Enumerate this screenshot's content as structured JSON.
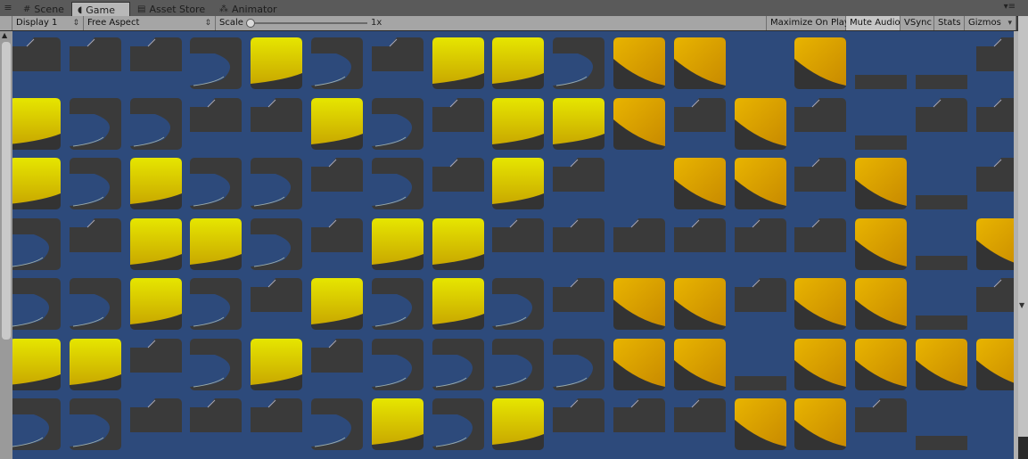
{
  "tabs": [
    {
      "label": "Scene",
      "icon": "scene-icon",
      "glyph": "#",
      "active": false
    },
    {
      "label": "Game",
      "icon": "game-icon",
      "glyph": "◖",
      "active": true
    },
    {
      "label": "Asset Store",
      "icon": "asset-store-icon",
      "glyph": "▤",
      "active": false
    },
    {
      "label": "Animator",
      "icon": "animator-icon",
      "glyph": "⁂",
      "active": false
    }
  ],
  "toolbar": {
    "display": "Display 1",
    "aspect": "Free Aspect",
    "scale_label": "Scale",
    "scale_value": "1x",
    "maximize": "Maximize On Play",
    "mute": "Mute Audio",
    "vsync": "VSync",
    "stats": "Stats",
    "gizmos": "Gizmos"
  },
  "colors": {
    "viewport": "#2d4a7b",
    "tile_dark": "#3a3a3a",
    "yellow_light": "#e6e600",
    "yellow_orange": "#e8b400"
  },
  "grid": {
    "legend": "Y=yellow-light D=dark-notch P=dark-pie-cut O=orange-corner T=dark-top B=dark-bottom E=empty",
    "rows": [
      "DDDPYPDYYPOOEOBBD",
      "YPPDDYPDYYODODBDD",
      "YPYPPDPDYDEOODOBD",
      "PDYYPDYYDDDDDDOBO",
      "PPYPDYPYPDOODOOBD",
      "YYDPYDPPPPOOBOOOO",
      "PPDDDPYPYDDDOODBE"
    ]
  }
}
